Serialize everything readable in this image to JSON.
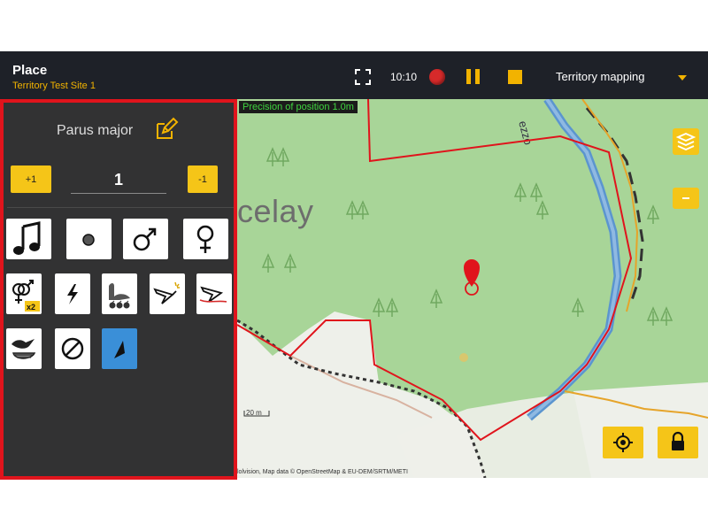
{
  "header": {
    "title": "Place",
    "subtitle": "Territory Test Site 1",
    "time": "10:10",
    "mode": "Territory mapping",
    "icons": [
      "fullscreen-icon",
      "record-icon",
      "pause-icon",
      "stop-icon",
      "dropdown-arrow-icon"
    ]
  },
  "panel": {
    "species": "Parus major",
    "plus_label": "+1",
    "count": "1",
    "minus_label": "-1",
    "x2_badge": "x2",
    "tiles": [
      "song-icon",
      "observed-icon",
      "male-icon",
      "female-icon",
      "pair-icon",
      "alarm-icon",
      "family-icon",
      "flight-icon",
      "flyover-icon",
      "nest-icon",
      "cancel-icon",
      "selected-tool-icon"
    ]
  },
  "map": {
    "precision": "Precision of position 1.0m",
    "place_label": "celay",
    "road_label": "ezzo",
    "scale": "20 m",
    "attribution": "lolvision, Map data © OpenStreetMap & EU-DEM/SRTM/METI"
  },
  "colors": {
    "accent": "#f5c518",
    "topbar": "#1e2128",
    "panel": "#323233",
    "highlight_border": "#e0141c",
    "map_green": "#a8d598",
    "territory_line": "#e0141c",
    "river": "#5b95cf"
  }
}
